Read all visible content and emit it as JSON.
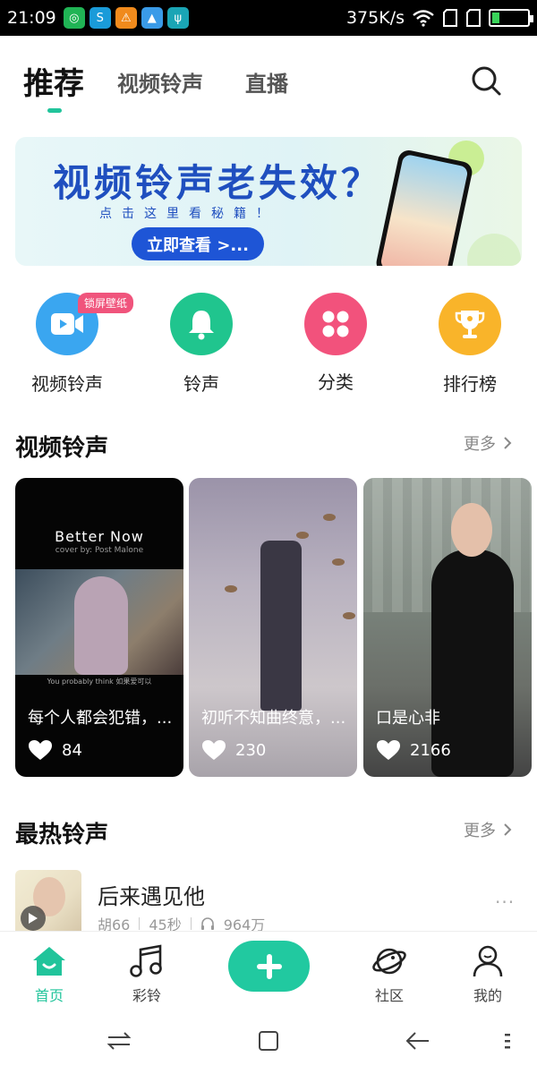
{
  "status_bar": {
    "time": "21:09",
    "net_speed": "375K/s",
    "battery_level": 0.2,
    "app_icons": [
      "wechat-icon",
      "app-icon",
      "warning-icon",
      "map-icon",
      "usb-icon"
    ]
  },
  "top_tabs": [
    {
      "label": "推荐",
      "active": true
    },
    {
      "label": "视频铃声",
      "active": false
    },
    {
      "label": "直播",
      "active": false
    }
  ],
  "banner": {
    "title": "视频铃声老失效？",
    "subtitle": "点击这里看秘籍！",
    "button": "立即查看 >..."
  },
  "quick_entries": [
    {
      "label": "视频铃声",
      "badge": "锁屏壁纸",
      "color": "#3aa6f0",
      "icon": "video-icon"
    },
    {
      "label": "铃声",
      "color": "#20c58e",
      "icon": "bell-icon"
    },
    {
      "label": "分类",
      "color": "#f2527c",
      "icon": "grid-icon"
    },
    {
      "label": "排行榜",
      "color": "#f9b42a",
      "icon": "trophy-icon"
    }
  ],
  "video_section": {
    "title": "视频铃声",
    "more": "更多",
    "cards": [
      {
        "title": "每个人都会犯错，...",
        "likes": "84",
        "overlay_title": "Better Now",
        "overlay_sub": "cover by: Post Malone",
        "caption": "You probably think\n如果爱可以"
      },
      {
        "title": "初听不知曲终意，...",
        "likes": "230"
      },
      {
        "title": "口是心非",
        "likes": "2166"
      }
    ]
  },
  "hot_section": {
    "title": "最热铃声",
    "more": "更多",
    "items": [
      {
        "name": "后来遇见他",
        "artist": "胡66",
        "duration": "45秒",
        "plays": "964万",
        "more": "···"
      }
    ]
  },
  "bottom_nav": [
    {
      "label": "首页",
      "active": true
    },
    {
      "label": "彩铃",
      "active": false
    },
    {
      "label": "社区",
      "active": false
    },
    {
      "label": "我的",
      "active": false
    }
  ],
  "colors": {
    "accent": "#21c49b",
    "banner_blue": "#1f4fbf"
  }
}
